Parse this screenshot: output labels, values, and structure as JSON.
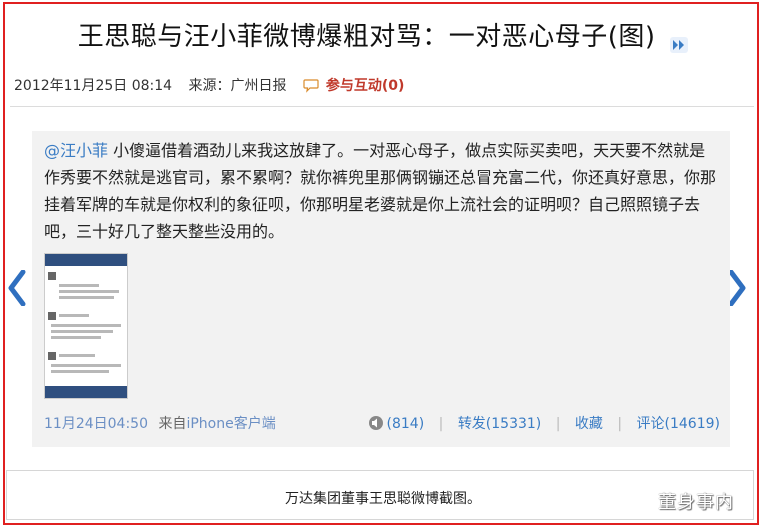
{
  "article": {
    "title": "王思聪与汪小菲微博爆粗对骂：一对恶心母子(图)",
    "date": "2012年11月25日 08:14",
    "source": "来源：广州日报",
    "comment_link": "参与互动(0)"
  },
  "weibo": {
    "mention": "@汪小菲",
    "text": " 小傻逼借着酒劲儿来我这放肆了。一对恶心母子，做点实际买卖吧，天天要不然就是作秀要不然就是逃官司，累不累啊？就你裤兜里那俩钢镚还总冒充富二代，你还真好意思，你那挂着军牌的车就是你权利的象征呗，你那明星老婆就是你上流社会的证明呗？自己照照镜子去吧，三十好几了整天整些没用的。",
    "time": "11月24日04:50",
    "via_prefix": "来自",
    "via_client": "iPhone客户端",
    "listen_count": "(814)",
    "repost": "转发(15331)",
    "favorite": "收藏",
    "comment": "评论(14619)"
  },
  "caption": "万达集团董事王思聪微博截图。",
  "watermark": "董身事内",
  "colors": {
    "frame": "#e02020",
    "link": "#3a7cc4",
    "accent": "#c0392b"
  },
  "icons": [
    "double-arrow-icon",
    "comment-bubble-icon",
    "speaker-icon",
    "chevron-left-icon",
    "chevron-right-icon"
  ]
}
